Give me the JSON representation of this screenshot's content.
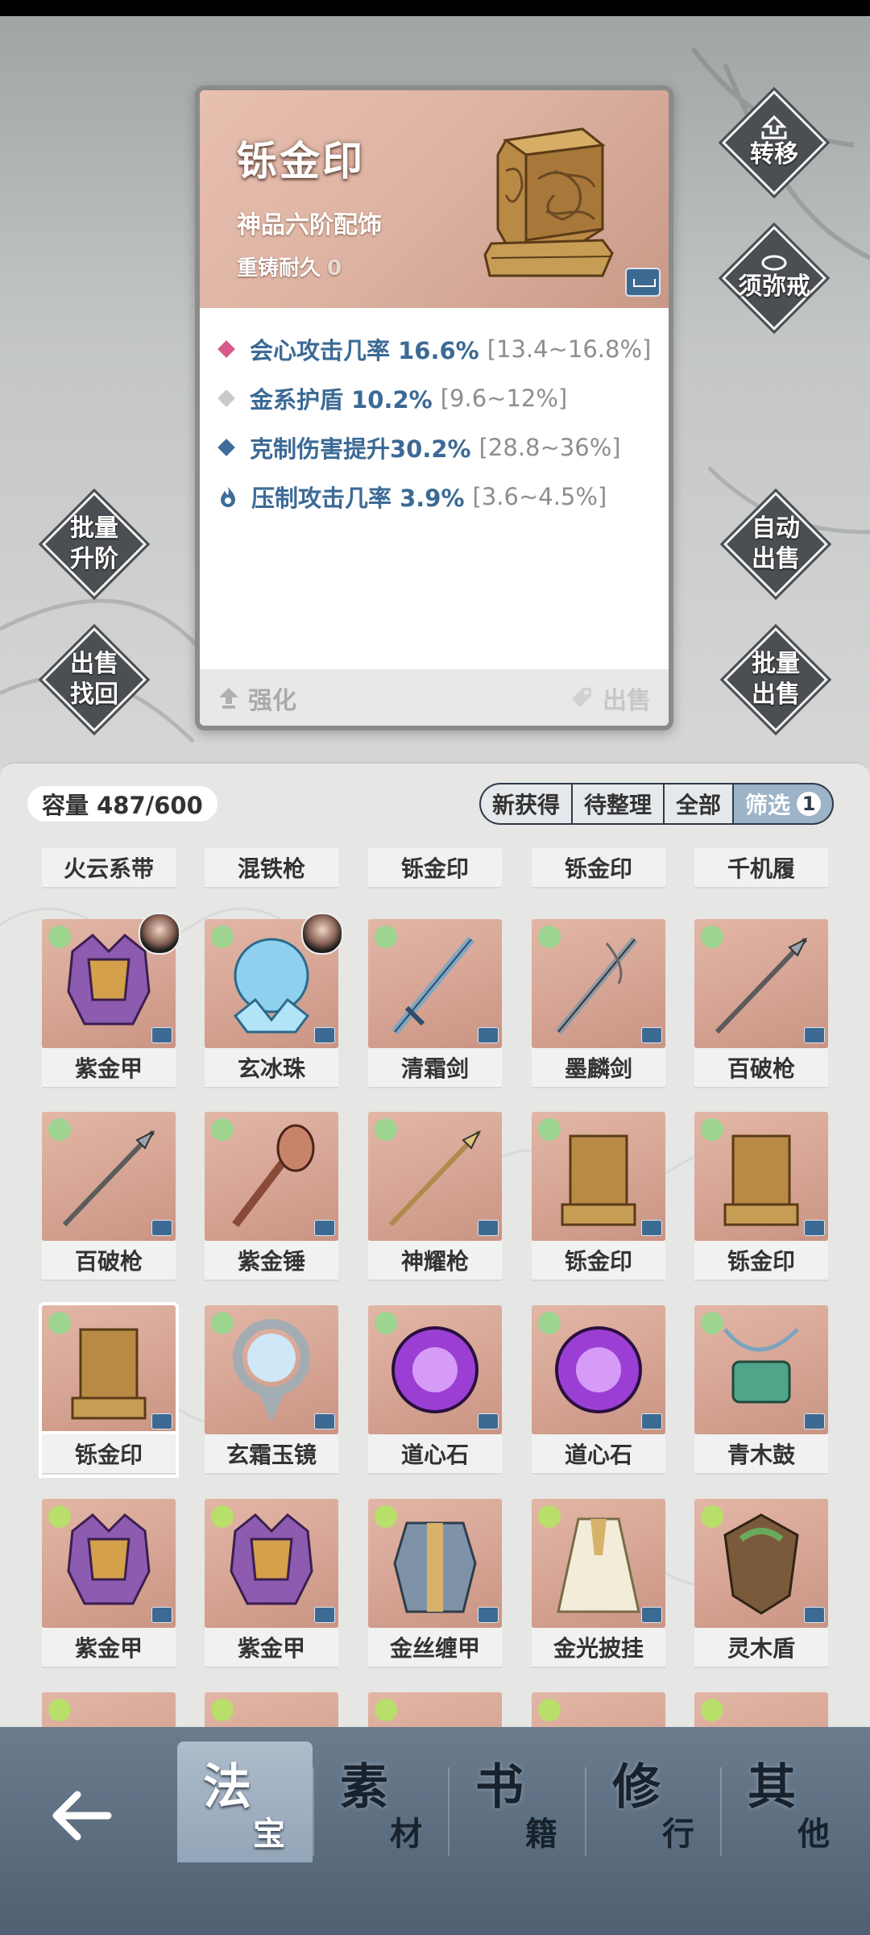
{
  "detail": {
    "name": "铄金印",
    "grade": "神品六阶配饰",
    "recast_label": "重铸耐久",
    "recast_value": "0",
    "stats": [
      {
        "name": "会心攻击几率 16.6%",
        "range": "[13.4~16.8%]",
        "color": "#d6598a",
        "icon": "diamond-icon"
      },
      {
        "name": "金系护盾 10.2%",
        "range": "[9.6~12%]",
        "color": "#c9c9c9",
        "icon": "diamond-icon"
      },
      {
        "name": "克制伤害提升30.2%",
        "range": "[28.8~36%]",
        "color": "#3f6d99",
        "icon": "diamond-icon"
      },
      {
        "name": "压制攻击几率 3.9%",
        "range": "[3.6~4.5%]",
        "color": "#3f6d99",
        "icon": "flame-icon"
      }
    ],
    "enhance_label": "强化",
    "sell_label": "出售"
  },
  "side_buttons": {
    "transfer": "转移",
    "ring": "须弥戒",
    "batch_upgrade": [
      "批量",
      "升阶"
    ],
    "sell_recover": [
      "出售",
      "找回"
    ],
    "auto_sell": [
      "自动",
      "出售"
    ],
    "batch_sell": [
      "批量",
      "出售"
    ]
  },
  "inventory": {
    "capacity": "容量 487/600",
    "filters": [
      "新获得",
      "待整理",
      "全部"
    ],
    "filter_active": "筛选",
    "filter_count": "1",
    "rows": [
      [
        "火云系带",
        "混铁枪",
        "铄金印",
        "铄金印",
        "千机履"
      ],
      [
        "紫金甲",
        "玄冰珠",
        "清霜剑",
        "墨麟剑",
        "百破枪"
      ],
      [
        "百破枪",
        "紫金锤",
        "神耀枪",
        "铄金印",
        "铄金印"
      ],
      [
        "铄金印",
        "玄霜玉镜",
        "道心石",
        "道心石",
        "青木鼓"
      ],
      [
        "紫金甲",
        "紫金甲",
        "金丝缠甲",
        "金光披挂",
        "灵木盾"
      ]
    ]
  },
  "bottom_tabs": [
    {
      "big": "法",
      "small": "宝",
      "active": true
    },
    {
      "big": "素",
      "small": "材",
      "active": false
    },
    {
      "big": "书",
      "small": "籍",
      "active": false
    },
    {
      "big": "修",
      "small": "行",
      "active": false
    },
    {
      "big": "其",
      "small": "他",
      "active": false
    }
  ]
}
